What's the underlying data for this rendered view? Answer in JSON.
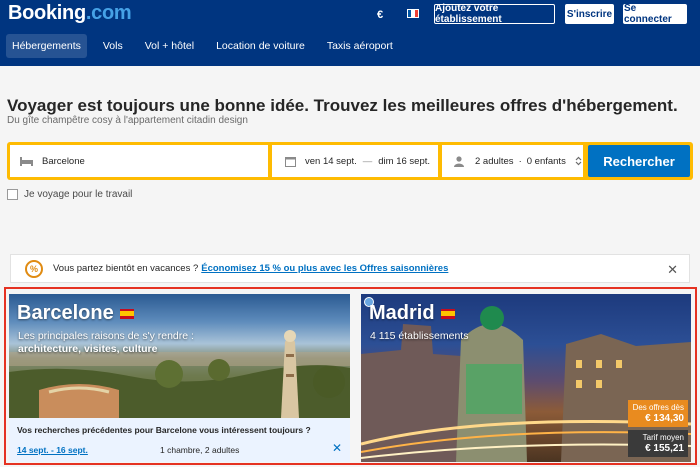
{
  "header": {
    "logo_main": "Booking",
    "logo_dot": ".com",
    "currency": "€",
    "add_property": "Ajoutez votre établissement",
    "register": "S'inscrire",
    "login": "Se connecter"
  },
  "nav": [
    "Hébergements",
    "Vols",
    "Vol + hôtel",
    "Location de voiture",
    "Taxis aéroport"
  ],
  "hero": {
    "title": "Voyager est toujours une bonne idée. Trouvez les meilleures offres d'hébergement.",
    "subtitle": "Du gîte champêtre cosy à l'appartement citadin design"
  },
  "search": {
    "destination": "Barcelone",
    "checkin": "ven 14 sept.",
    "dash": "—",
    "checkout": "dim 16 sept.",
    "adults": "2 adultes",
    "sep": "·",
    "children": "0 enfants",
    "button": "Rechercher",
    "work_travel": "Je voyage pour le travail"
  },
  "banner": {
    "text": "Vous partez bientôt en vacances ?",
    "link": "Économisez 15 % ou plus avec les Offres saisonnières"
  },
  "cards": {
    "barcelona": {
      "title": "Barcelone",
      "line1": "Les principales raisons de s'y rendre :",
      "line2": "architecture, visites, culture",
      "recent_question": "Vos recherches précédentes pour Barcelone vous intéressent toujours ?",
      "recent_dates": "14 sept. - 16 sept.",
      "recent_rooms": "1 chambre, 2 adultes"
    },
    "madrid": {
      "title": "Madrid",
      "count": "4 115 établissements",
      "offer_label": "Des offres dès",
      "offer_price": "€ 134,30",
      "avg_label": "Tarif moyen",
      "avg_price": "€ 155,21"
    }
  },
  "colors": {
    "brand": "#003580",
    "accent": "#0071c2",
    "search_border": "#febb02",
    "highlight": "#e53222"
  }
}
